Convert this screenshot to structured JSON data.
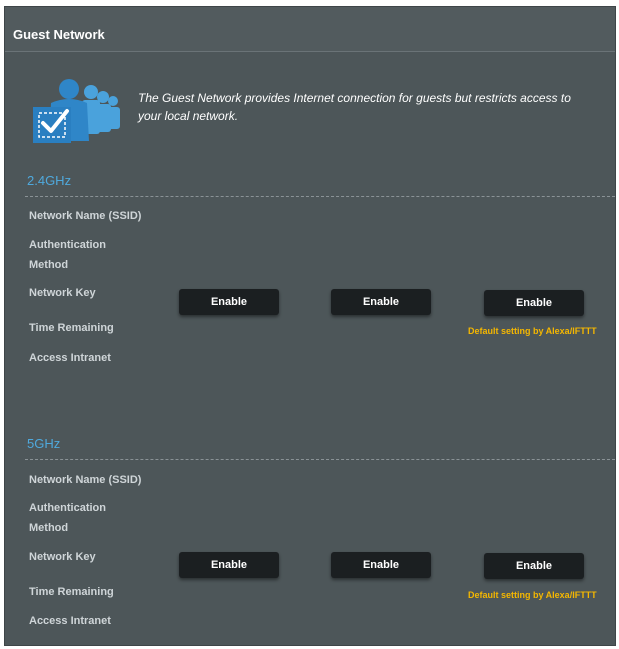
{
  "header": {
    "title": "Guest Network"
  },
  "intro": {
    "description": "The Guest Network provides Internet connection for guests but restricts access to your local network.",
    "icon": "guest-users-icon"
  },
  "bands": [
    {
      "title": "2.4GHz",
      "labels": {
        "ssid": "Network Name (SSID)",
        "auth": "Authentication Method",
        "key": "Network Key",
        "time": "Time Remaining",
        "intranet": "Access Intranet"
      },
      "buttons": [
        "Enable",
        "Enable",
        "Enable"
      ],
      "note": "Default setting by Alexa/IFTTT"
    },
    {
      "title": "5GHz",
      "labels": {
        "ssid": "Network Name (SSID)",
        "auth": "Authentication Method",
        "key": "Network Key",
        "time": "Time Remaining",
        "intranet": "Access Intranet"
      },
      "buttons": [
        "Enable",
        "Enable",
        "Enable"
      ],
      "note": "Default setting by Alexa/IFTTT"
    }
  ],
  "colors": {
    "panel_background": "#4d5659",
    "band_title": "#4fa9dd",
    "note": "#f5b700",
    "button": "#1b1f21"
  }
}
